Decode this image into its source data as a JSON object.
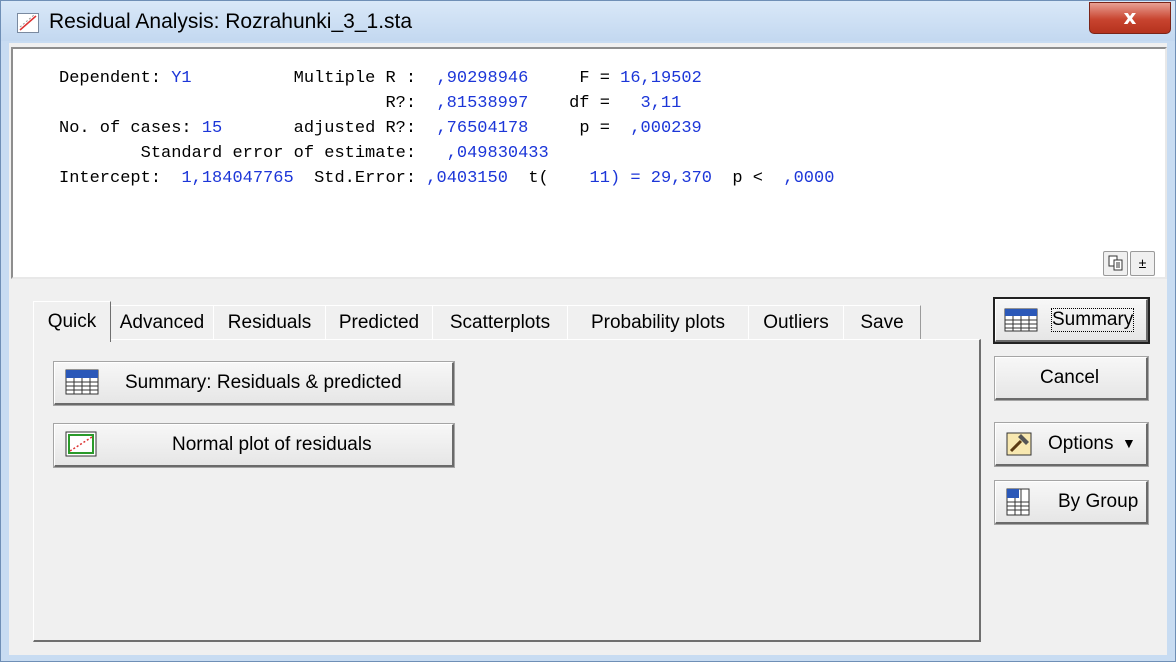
{
  "window": {
    "title": "Residual Analysis: Rozrahunki_3_1.sta",
    "close_symbol": "x"
  },
  "results": {
    "line1": {
      "label_dep": "Dependent:",
      "dep_value": "Y1",
      "label_r": "Multiple R :",
      "r_value": ",90298946",
      "label_f": "F =",
      "f_value": "16,19502"
    },
    "line2": {
      "label_r2": "R?:",
      "r2_value": ",81538997",
      "label_df": "df =",
      "df_value": "3,11"
    },
    "line3": {
      "label_cases": "No. of cases:",
      "cases_value": "15",
      "label_adj": "adjusted R?:",
      "adj_value": ",76504178",
      "label_p": "p =",
      "p_value": ",000239"
    },
    "line4": {
      "label_se": "Standard error of estimate:",
      "se_value": ",049830433"
    },
    "line5": {
      "label_int": "Intercept:",
      "int_value": "1,184047765",
      "label_stderr": "Std.Error:",
      "stderr_value": ",0403150",
      "label_t": "t(",
      "t_df": "11) = 29,370",
      "label_p": "p <",
      "p_value": ",0000"
    }
  },
  "toolbar_small": {
    "copy_icon": "copy-icon",
    "collapse_symbol": "±"
  },
  "tabs": [
    {
      "label": "Quick",
      "active": true
    },
    {
      "label": "Advanced"
    },
    {
      "label": "Residuals"
    },
    {
      "label": "Predicted"
    },
    {
      "label": "Scatterplots"
    },
    {
      "label": "Probability plots"
    },
    {
      "label": "Outliers"
    },
    {
      "label": "Save"
    }
  ],
  "quick": {
    "summary_button": "Summary:  Residuals & predicted",
    "normal_plot_button": "Normal plot of residuals"
  },
  "side_buttons": {
    "summary": "Summary",
    "cancel": "Cancel",
    "options": "Options",
    "by_group": "By Group"
  },
  "colors": {
    "value_text": "#1c36d8",
    "close_button": "#c8442f"
  }
}
